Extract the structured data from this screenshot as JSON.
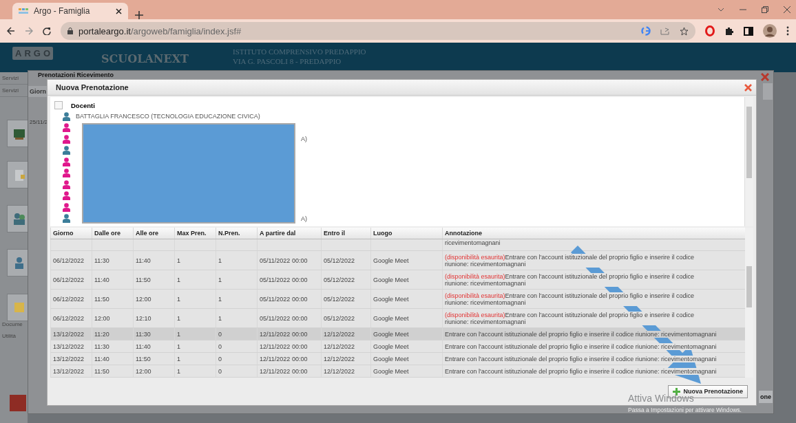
{
  "browser": {
    "tab_title": "Argo - Famiglia",
    "url_host": "portaleargo.it",
    "url_path": "/argoweb/famiglia/index.jsf#"
  },
  "app_header": {
    "logo": "ARGO",
    "product": "SCUOLANEXT",
    "school": "ISTITUTO COMPRENSIVO PREDAPPIO",
    "address": "VIA G. PASCOLI 8 - PREDAPPIO"
  },
  "background": {
    "sidebar_items": [
      "Servizi",
      "Servizi"
    ],
    "lower_items": [
      "Docume",
      "Utilità"
    ],
    "outer_dialog_title": "Prenotazioni Ricevimento",
    "column": "Giorn",
    "date": "25/11/2",
    "button_tail": "one"
  },
  "dialog": {
    "title": "Nuova Prenotazione",
    "tree_root": "Docenti",
    "tree_root_checked": false,
    "teachers": [
      {
        "color": "#3b7d99",
        "name": "BATTAGLIA FRANCESCO (TECNOLOGIA EDUCAZIONE CIVICA)"
      },
      {
        "color": "#e0188c"
      },
      {
        "color": "#e0188c",
        "tail": "A)"
      },
      {
        "color": "#3b7d99"
      },
      {
        "color": "#e0188c"
      },
      {
        "color": "#e0188c"
      },
      {
        "color": "#e0188c"
      },
      {
        "color": "#e0188c"
      },
      {
        "color": "#e0188c"
      },
      {
        "color": "#3b7d99",
        "tail": "A)"
      }
    ],
    "table": {
      "columns": [
        "Giorno",
        "Dalle ore",
        "Alle ore",
        "Max Pren.",
        "N.Pren.",
        "A partire dal",
        "Entro il",
        "Luogo",
        "Annotazione"
      ],
      "rows": [
        {
          "kind": "partial",
          "note": "ricevimentomagnani",
          "selected": false
        },
        {
          "kind": "full",
          "cells": [
            "06/12/2022",
            "11:30",
            "11:40",
            "1",
            "1",
            "05/11/2022 00:00",
            "05/12/2022",
            "Google Meet"
          ],
          "note_prefix": "(disponibilità esaurita)",
          "note": "Entrare con l'account istituzionale del proprio figlio e inserire il codice riunione: ricevimentomagnani",
          "selected": false
        },
        {
          "kind": "full",
          "cells": [
            "06/12/2022",
            "11:40",
            "11:50",
            "1",
            "1",
            "05/11/2022 00:00",
            "05/12/2022",
            "Google Meet"
          ],
          "note_prefix": "(disponibilità esaurita)",
          "note": "Entrare con l'account istituzionale del proprio figlio e inserire il codice riunione: ricevimentomagnani",
          "selected": false
        },
        {
          "kind": "full",
          "cells": [
            "06/12/2022",
            "11:50",
            "12:00",
            "1",
            "1",
            "05/11/2022 00:00",
            "05/12/2022",
            "Google Meet"
          ],
          "note_prefix": "(disponibilità esaurita)",
          "note": "Entrare con l'account istituzionale del proprio figlio e inserire il codice riunione: ricevimentomagnani",
          "selected": false
        },
        {
          "kind": "full",
          "cells": [
            "06/12/2022",
            "12:00",
            "12:10",
            "1",
            "1",
            "05/11/2022 00:00",
            "05/12/2022",
            "Google Meet"
          ],
          "note_prefix": "(disponibilità esaurita)",
          "note": "Entrare con l'account istituzionale del proprio figlio e inserire il codice riunione: ricevimentomagnani",
          "selected": false
        },
        {
          "kind": "full",
          "cells": [
            "13/12/2022",
            "11:20",
            "11:30",
            "1",
            "0",
            "12/11/2022 00:00",
            "12/12/2022",
            "Google Meet"
          ],
          "note": "Entrare con l'account istituzionale del proprio figlio e inserire il codice riunione: ricevimentomagnani",
          "selected": true
        },
        {
          "kind": "full",
          "cells": [
            "13/12/2022",
            "11:30",
            "11:40",
            "1",
            "0",
            "12/11/2022 00:00",
            "12/12/2022",
            "Google Meet"
          ],
          "note": "Entrare con l'account istituzionale del proprio figlio e inserire il codice riunione: ricevimentomagnani",
          "selected": false
        },
        {
          "kind": "full",
          "cells": [
            "13/12/2022",
            "11:40",
            "11:50",
            "1",
            "0",
            "12/11/2022 00:00",
            "12/12/2022",
            "Google Meet"
          ],
          "note": "Entrare con l'account istituzionale del proprio figlio e inserire il codice riunione: ricevimentomagnani",
          "selected": false
        },
        {
          "kind": "full",
          "cells": [
            "13/12/2022",
            "11:50",
            "12:00",
            "1",
            "0",
            "12/11/2022 00:00",
            "12/12/2022",
            "Google Meet"
          ],
          "note": "Entrare con l'account istituzionale del proprio figlio e inserire il codice riunione: ricevimentomagnani",
          "selected": false
        }
      ]
    },
    "button": "Nuova Prenotazione"
  },
  "windows_notice": {
    "title": "Attiva Windows",
    "hint": "Passa a Impostazioni per attivare Windows."
  }
}
